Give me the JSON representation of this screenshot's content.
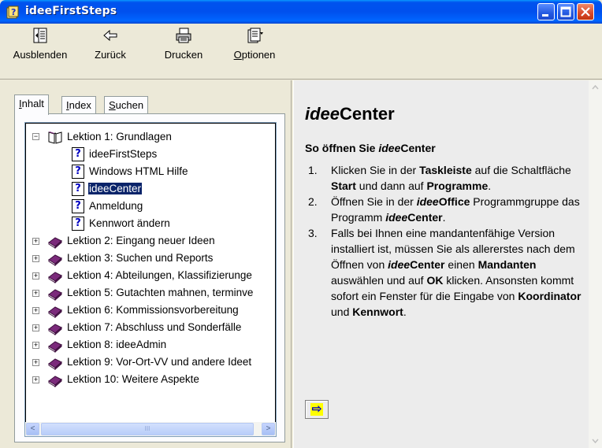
{
  "window": {
    "title": "ideeFirstSteps"
  },
  "toolbar": {
    "items": [
      {
        "label": "Ausblenden",
        "icon": "hide-icon"
      },
      {
        "label": "Zurück",
        "icon": "back-arrow-icon"
      },
      {
        "label": "Drucken",
        "icon": "printer-icon"
      },
      {
        "label_underlined": "O",
        "label_rest": "ptionen",
        "icon": "options-icon"
      }
    ]
  },
  "tabs": [
    {
      "label_underlined": "I",
      "label_rest": "nhalt",
      "active": true
    },
    {
      "label_underlined": "I",
      "label_rest": "ndex",
      "active": false
    },
    {
      "label_underlined": "S",
      "label_rest": "uchen",
      "active": false
    }
  ],
  "tree": {
    "lesson1": {
      "label": "Lektion 1: Grundlagen",
      "expander": "−",
      "children": [
        {
          "label": "ideeFirstSteps",
          "icon": "?"
        },
        {
          "label": "Windows HTML Hilfe",
          "icon": "?"
        },
        {
          "label": "ideeCenter",
          "icon": "?",
          "selected": true
        },
        {
          "label": "Anmeldung",
          "icon": "?"
        },
        {
          "label": "Kennwort ändern",
          "icon": "?"
        }
      ]
    },
    "lessons": [
      {
        "label": "Lektion 2: Eingang neuer Ideen",
        "expander": "+"
      },
      {
        "label": "Lektion 3: Suchen und Reports",
        "expander": "+"
      },
      {
        "label": "Lektion 4: Abteilungen, Klassifizierunge",
        "expander": "+"
      },
      {
        "label": "Lektion 5: Gutachten mahnen, terminve",
        "expander": "+"
      },
      {
        "label": "Lektion 6: Kommissionsvorbereitung",
        "expander": "+"
      },
      {
        "label": "Lektion 7: Abschluss und Sonderfälle",
        "expander": "+"
      },
      {
        "label": "Lektion 8: ideeAdmin",
        "expander": "+"
      },
      {
        "label": "Lektion 9: Vor-Ort-VV und andere Ideet",
        "expander": "+"
      },
      {
        "label": "Lektion 10: Weitere Aspekte",
        "expander": "+"
      }
    ],
    "scroll": {
      "left": "<",
      "right": ">",
      "thumb_grip": "III"
    }
  },
  "content": {
    "heading_italic": "idee",
    "heading_rest": "Center",
    "subheading_pre": "So öffnen Sie ",
    "subheading_italic": "idee",
    "subheading_post": "Center",
    "steps": [
      {
        "num": "1.",
        "parts": {
          "a": "Klicken Sie in der ",
          "b": "Taskleiste",
          "c": " auf die Schaltfläche ",
          "d": "Start",
          "e": " und dann auf ",
          "f": "Programme",
          "g": "."
        }
      },
      {
        "num": "2.",
        "parts": {
          "a": "Öffnen Sie in der ",
          "b": "idee",
          "c": "Office",
          "d": " Programmgruppe das Programm ",
          "e": "idee",
          "f": "Center",
          "g": "."
        }
      },
      {
        "num": "3.",
        "parts": {
          "a": "Falls bei Ihnen eine mandantenfähige Version installiert ist, müssen Sie als allererstes nach dem Öffnen von ",
          "b": "idee",
          "c": "Center",
          "d": " einen ",
          "e": "Mandanten",
          "f": " auswählen und auf ",
          "g": "OK",
          "h": " klicken. Ansonsten kommt sofort ein Fenster für die Eingabe von ",
          "i": "Koordinator",
          "j": " und ",
          "k": "Kennwort",
          "l": "."
        }
      }
    ],
    "next_button": "⇨"
  },
  "colors": {
    "titlebar": "#0053ee",
    "selection": "#0a246a",
    "book": "#7b2a7b",
    "help_icon_text": "#0000c0"
  }
}
